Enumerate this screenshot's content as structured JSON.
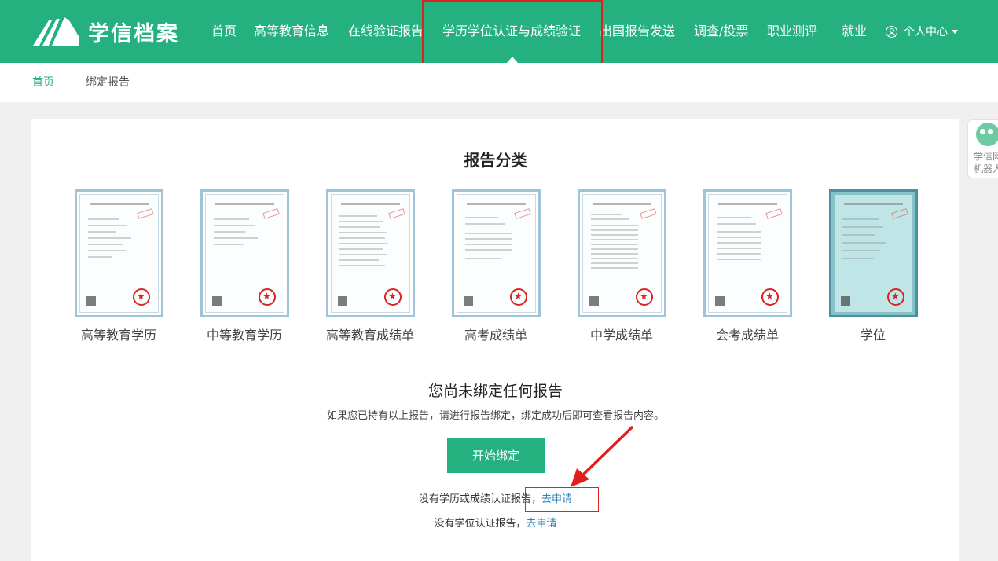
{
  "header": {
    "logo_text": "学信档案",
    "nav": [
      {
        "label": "首页"
      },
      {
        "label": "高等教育信息"
      },
      {
        "label": "在线验证报告"
      },
      {
        "label": "学历学位认证与成绩验证",
        "active": true
      },
      {
        "label": "出国报告发送"
      },
      {
        "label": "调查/投票"
      },
      {
        "label": "职业测评"
      },
      {
        "label": "就业"
      }
    ],
    "user_center": "个人中心"
  },
  "breadcrumb": {
    "home": "首页",
    "current": "绑定报告"
  },
  "main": {
    "title": "报告分类",
    "reports": [
      {
        "label": "高等教育学历",
        "style": "light"
      },
      {
        "label": "中等教育学历",
        "style": "light"
      },
      {
        "label": "高等教育成绩单",
        "style": "light"
      },
      {
        "label": "高考成绩单",
        "style": "light"
      },
      {
        "label": "中学成绩单",
        "style": "light"
      },
      {
        "label": "会考成绩单",
        "style": "light"
      },
      {
        "label": "学位",
        "style": "teal"
      }
    ],
    "empty_title": "您尚未绑定任何报告",
    "empty_desc": "如果您已持有以上报告，请进行报告绑定，绑定成功后即可查看报告内容。",
    "bind_button": "开始绑定",
    "apply_1_text": "没有学历或成绩认证报告，",
    "apply_1_link": "去申请",
    "apply_2_text": "没有学位认证报告，",
    "apply_2_link": "去申请"
  },
  "side_widget": {
    "line1": "学信网",
    "line2": "机器人"
  },
  "colors": {
    "brand": "#25b080",
    "annotation": "#d9241f",
    "link": "#2a7fb8"
  }
}
